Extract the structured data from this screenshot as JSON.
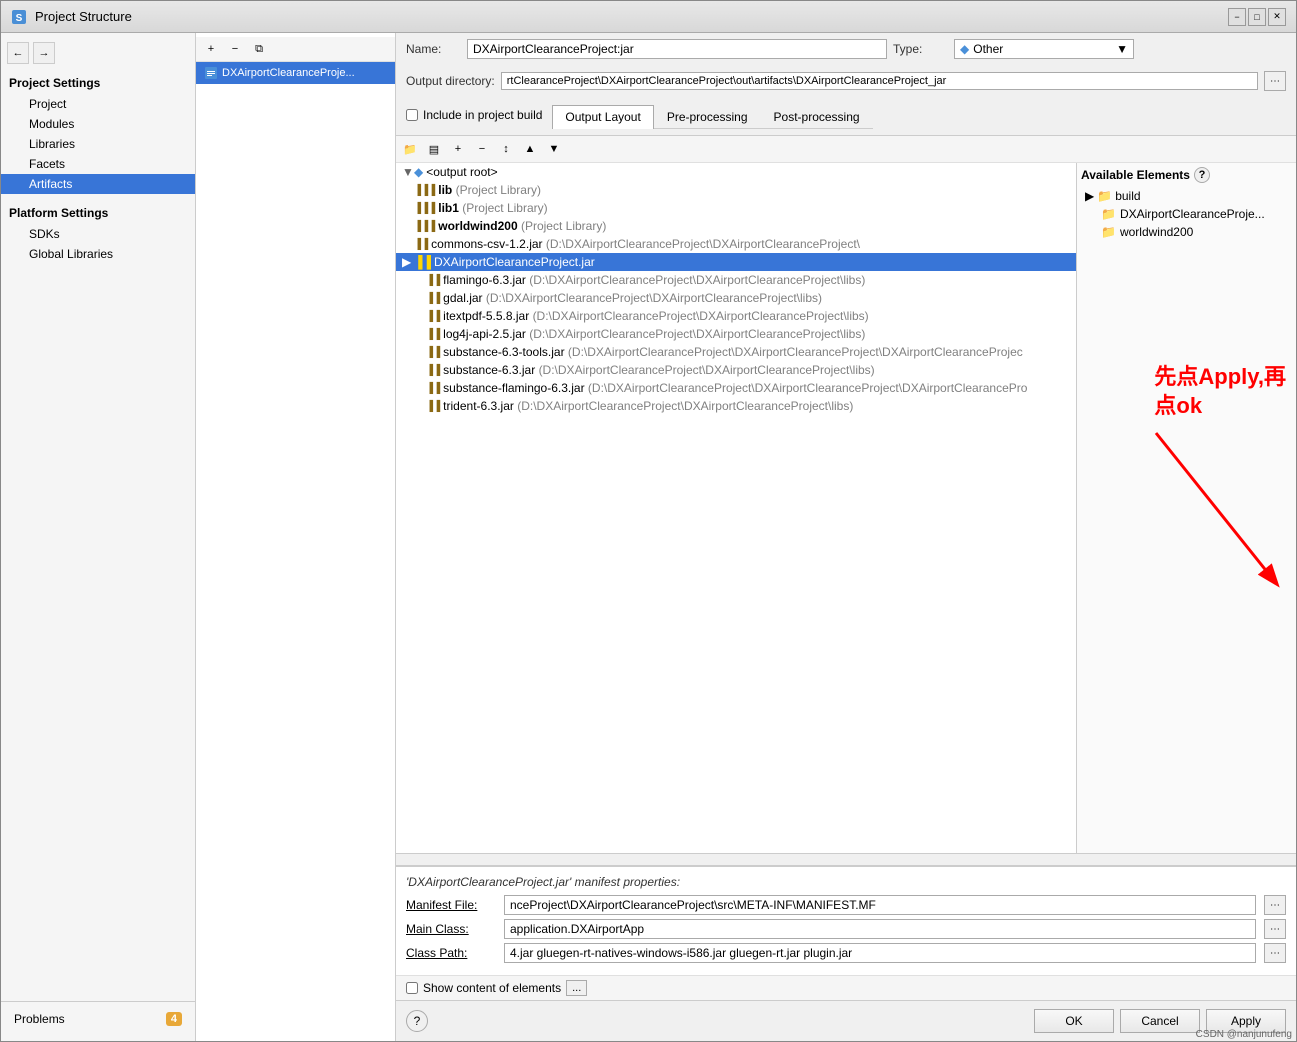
{
  "window": {
    "title": "Project Structure"
  },
  "sidebar": {
    "nav_back": "←",
    "nav_forward": "→",
    "project_settings_label": "Project Settings",
    "items": [
      {
        "label": "Project",
        "active": false,
        "sub": false
      },
      {
        "label": "Modules",
        "active": false,
        "sub": false
      },
      {
        "label": "Libraries",
        "active": false,
        "sub": false
      },
      {
        "label": "Facets",
        "active": false,
        "sub": false
      },
      {
        "label": "Artifacts",
        "active": true,
        "sub": false
      }
    ],
    "platform_label": "Platform Settings",
    "platform_items": [
      {
        "label": "SDKs"
      },
      {
        "label": "Global Libraries"
      }
    ],
    "problems_label": "Problems",
    "problems_count": "4"
  },
  "artifact": {
    "name": "DXAirportClearanceProject",
    "entry_label": "DXAirportClearanceProje..."
  },
  "name_field": {
    "label": "Name:",
    "value": "DXAirportClearanceProject:jar"
  },
  "type_field": {
    "label": "Type:",
    "icon": "◆",
    "value": "Other"
  },
  "output_dir": {
    "label": "Output directory:",
    "value": "rtClearanceProject\\DXAirportClearanceProject\\out\\artifacts\\DXAirportClearanceProject_jar"
  },
  "include_build": {
    "label": "Include in project build",
    "checked": false
  },
  "tabs": [
    {
      "label": "Output Layout",
      "active": true
    },
    {
      "label": "Pre-processing",
      "active": false
    },
    {
      "label": "Post-processing",
      "active": false
    }
  ],
  "toolbar_buttons": [
    {
      "icon": "📁",
      "title": "folder"
    },
    {
      "icon": "▤",
      "title": "list"
    },
    {
      "icon": "+",
      "title": "add"
    },
    {
      "icon": "−",
      "title": "remove"
    },
    {
      "icon": "↕",
      "title": "sort"
    },
    {
      "icon": "▲",
      "title": "up"
    },
    {
      "icon": "▼",
      "title": "down"
    }
  ],
  "tree": {
    "root": "<output root>",
    "items": [
      {
        "indent": 1,
        "label": "lib",
        "suffix": " (Project Library)",
        "type": "lib",
        "jar": false
      },
      {
        "indent": 1,
        "label": "lib1",
        "suffix": " (Project Library)",
        "type": "lib",
        "jar": false
      },
      {
        "indent": 1,
        "label": "worldwind200",
        "suffix": " (Project Library)",
        "type": "lib",
        "jar": false
      },
      {
        "indent": 1,
        "label": "commons-csv-1.2.jar",
        "suffix": " (D:\\DXAirportClearanceProject\\DXAirportClearanceProject\\",
        "type": "jar",
        "jar": true
      },
      {
        "indent": 1,
        "label": "DXAirportClearanceProject.jar",
        "suffix": "",
        "type": "jar_selected",
        "jar": true
      },
      {
        "indent": 2,
        "label": "flamingo-6.3.jar",
        "suffix": " (D:\\DXAirportClearanceProject\\DXAirportClearanceProject\\libs)",
        "type": "jar",
        "jar": true
      },
      {
        "indent": 2,
        "label": "gdal.jar",
        "suffix": " (D:\\DXAirportClearanceProject\\DXAirportClearanceProject\\libs)",
        "type": "jar",
        "jar": true
      },
      {
        "indent": 2,
        "label": "itextpdf-5.5.8.jar",
        "suffix": " (D:\\DXAirportClearanceProject\\DXAirportClearanceProject\\libs)",
        "type": "jar",
        "jar": true
      },
      {
        "indent": 2,
        "label": "log4j-api-2.5.jar",
        "suffix": " (D:\\DXAirportClearanceProject\\DXAirportClearanceProject\\libs)",
        "type": "jar",
        "jar": true
      },
      {
        "indent": 2,
        "label": "substance-6.3-tools.jar",
        "suffix": " (D:\\DXAirportClearanceProject\\DXAirportClearanceProject\\DXAirportClearanceProjec",
        "type": "jar",
        "jar": true
      },
      {
        "indent": 2,
        "label": "substance-6.3.jar",
        "suffix": " (D:\\DXAirportClearanceProject\\DXAirportClearanceProject\\libs)",
        "type": "jar",
        "jar": true
      },
      {
        "indent": 2,
        "label": "substance-flamingo-6.3.jar",
        "suffix": " (D:\\DXAirportClearanceProject\\DXAirportClearanceProject\\DXAirportClearancePro",
        "type": "jar",
        "jar": true
      },
      {
        "indent": 2,
        "label": "trident-6.3.jar",
        "suffix": " (D:\\DXAirportClearanceProject\\DXAirportClearanceProject\\libs)",
        "type": "jar",
        "jar": true
      }
    ]
  },
  "available": {
    "header": "Available Elements",
    "help_icon": "?",
    "items": [
      {
        "label": "build",
        "type": "folder",
        "expanded": false,
        "indent": 0
      },
      {
        "label": "DXAirportClearanceProje...",
        "type": "folder",
        "indent": 0
      },
      {
        "label": "worldwind200",
        "type": "folder",
        "indent": 0
      }
    ]
  },
  "manifest": {
    "title": "'DXAirportClearanceProject.jar' manifest properties:",
    "file_label": "Manifest File:",
    "file_value": "nceProject\\DXAirportClearanceProject\\src\\META-INF\\MANIFEST.MF",
    "main_class_label": "Main Class:",
    "main_class_value": "application.DXAirportApp",
    "classpath_label": "Class Path:",
    "classpath_value": "4.jar gluegen-rt-natives-windows-i586.jar gluegen-rt.jar plugin.jar"
  },
  "show_content": {
    "label": "Show content of elements",
    "checked": false,
    "more_btn": "..."
  },
  "buttons": {
    "ok": "OK",
    "cancel": "Cancel",
    "apply": "Apply"
  },
  "annotation": {
    "line1": "先点Apply,再",
    "line2": "点ok",
    "attribution": "CSDN @nanjunufeng"
  }
}
